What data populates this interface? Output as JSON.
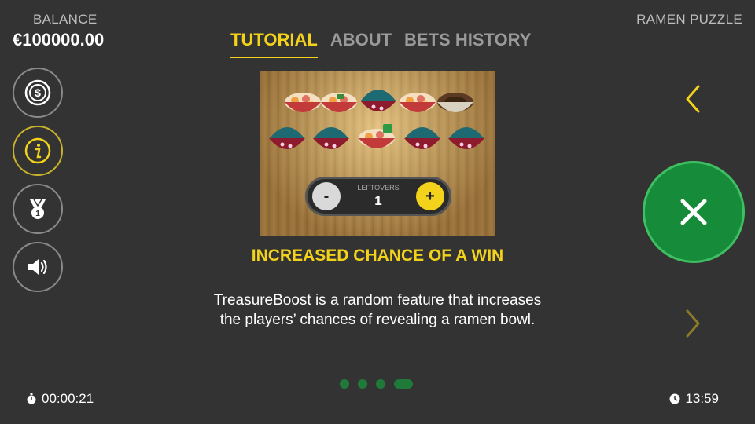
{
  "header": {
    "balance_label": "BALANCE",
    "balance_value": "€100000.00",
    "game_title": "RAMEN PUZZLE"
  },
  "tabs": [
    {
      "label": "TUTORIAL",
      "active": true
    },
    {
      "label": "ABOUT",
      "active": false
    },
    {
      "label": "BETS HISTORY",
      "active": false
    }
  ],
  "sidebar": {
    "items": [
      {
        "icon": "dollar-coin-icon",
        "active": false
      },
      {
        "icon": "info-icon",
        "active": true
      },
      {
        "icon": "medal-icon",
        "active": false
      },
      {
        "icon": "speaker-icon",
        "active": false
      }
    ]
  },
  "tutorial": {
    "leftovers_label": "LEFTOVERS",
    "leftovers_value": "1",
    "minus_label": "-",
    "plus_label": "+",
    "heading": "INCREASED CHANCE OF A WIN",
    "description": "TreasureBoost is a random feature that increases the players’ chances of revealing a ramen bowl.",
    "page_count": 4,
    "current_page": 4
  },
  "footer": {
    "session_timer": "00:00:21",
    "clock": "13:59"
  },
  "colors": {
    "accent_yellow": "#f2d21b",
    "close_green": "#168c3b",
    "background": "#333333"
  }
}
